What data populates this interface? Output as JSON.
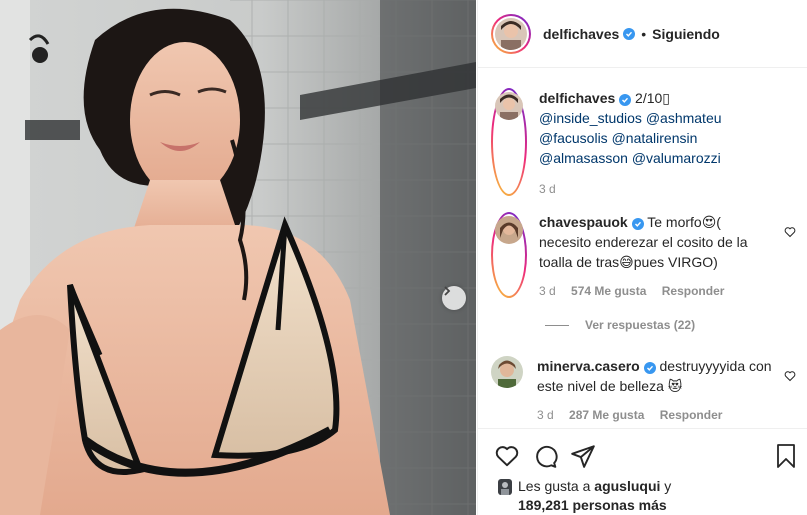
{
  "post": {
    "username": "delfichaves",
    "follow_status": "Siguiendo",
    "separator": "•"
  },
  "caption": {
    "username": "delfichaves",
    "text": "2/10",
    "emoji_box": "▯",
    "mentions": [
      "@inside_studios",
      "@ashmateu",
      "@facusolis",
      "@natalirensin",
      "@almasasson",
      "@valumarozzi"
    ],
    "time": "3 d"
  },
  "comments": [
    {
      "username": "chavespauok",
      "text": "Te morfo😍( necesito enderezar el cosito de la toalla de tras😅pues VIRGO)",
      "time": "3 d",
      "likes": "574 Me gusta",
      "reply": "Responder"
    },
    {
      "username": "minerva.casero",
      "text": "destruyyyyida con este nivel de belleza 😻",
      "time": "3 d",
      "likes": "287 Me gusta",
      "reply": "Responder"
    }
  ],
  "view_replies": "Ver respuestas (22)",
  "likes_summary": {
    "prefix": "Les gusta a",
    "user": "agusluqui",
    "joiner": "y",
    "count": "189,281 personas más"
  },
  "colors": {
    "verified": "#3897f0",
    "mention": "#00376b",
    "muted": "#8e8e8e"
  }
}
